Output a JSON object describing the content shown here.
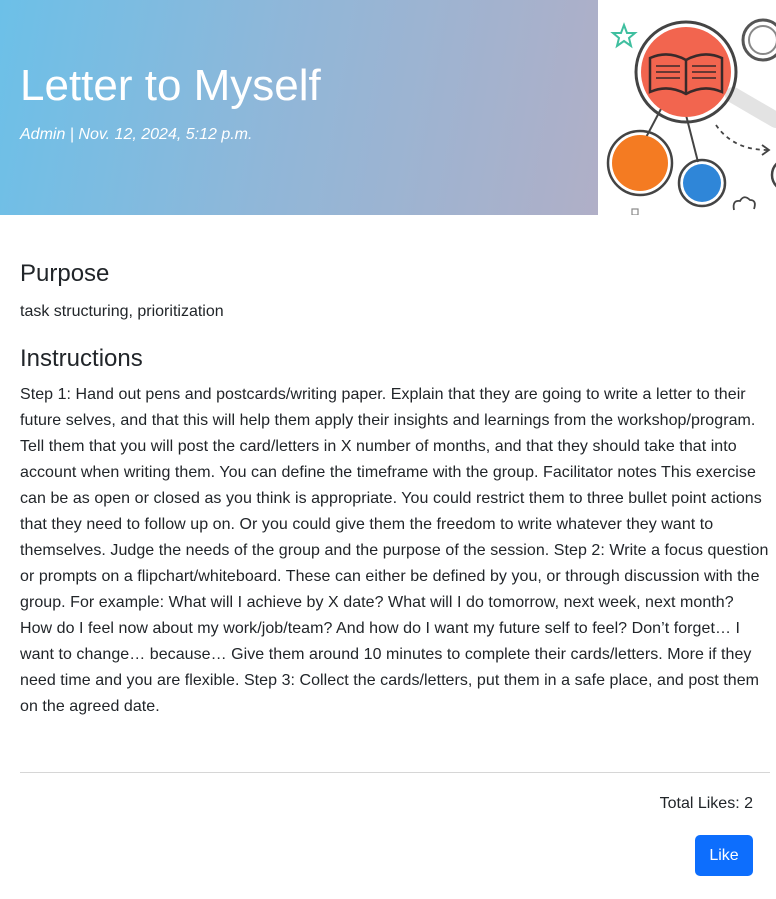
{
  "header": {
    "title": "Letter to Myself",
    "meta": "Admin | Nov. 12, 2024, 5:12 p.m.",
    "illustration_icon": "mind-map-book-illustration"
  },
  "purpose": {
    "heading": "Purpose",
    "text": "task structuring, prioritization"
  },
  "instructions": {
    "heading": "Instructions",
    "text": "Step 1: Hand out pens and postcards/writing paper. Explain that they are going to write a letter to their future selves, and that this will help them apply their insights and learnings from the workshop/program. Tell them that you will post the card/letters in X number of months, and that they should take that into account when writing them. You can define the timeframe with the group. Facilitator notes This exercise can be as open or closed as you think is appropriate. You could restrict them to three bullet point actions that they need to follow up on. Or you could give them the freedom to write whatever they want to themselves. Judge the needs of the group and the purpose of the session. Step 2: Write a focus question or prompts on a flipchart/whiteboard. These can either be defined by you, or through discussion with the group. For example: What will I achieve by X date? What will I do tomorrow, next week, next month? How do I feel now about my work/job/team? And how do I want my future self to feel? Don’t forget… I want to change… because… Give them around 10 minutes to complete their cards/letters. More if they need time and you are flexible. Step 3: Collect the cards/letters, put them in a safe place, and post them on the agreed date."
  },
  "footer": {
    "likes_text": "Total Likes: 2",
    "like_button_label": "Like"
  },
  "colors": {
    "accent": "#0d6efd",
    "hero_gradient_start": "#6cc0e8",
    "hero_gradient_end": "#b0afc7"
  }
}
